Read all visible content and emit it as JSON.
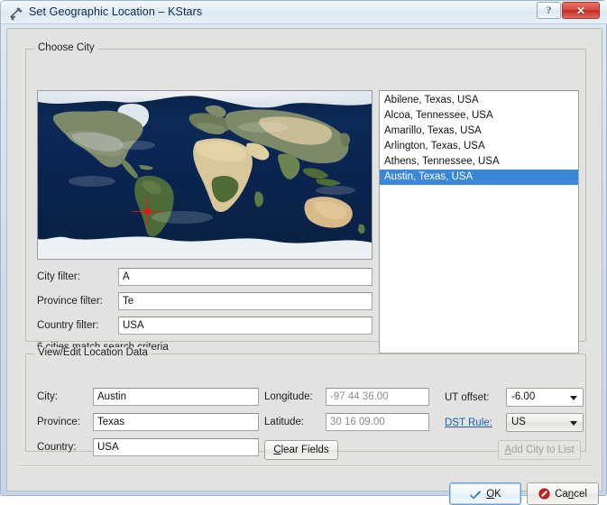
{
  "window": {
    "title": "Set Geographic Location – KStars",
    "icon": "telescope-icon",
    "help_label": "?",
    "close_label": "✕"
  },
  "choose_city": {
    "group_label": "Choose City",
    "map": {
      "name": "world-map",
      "marker_label": "selected-location-marker"
    },
    "filters": [
      {
        "label": "City filter:",
        "value": "A",
        "name": "city-filter-input"
      },
      {
        "label": "Province filter:",
        "value": "Te",
        "name": "province-filter-input"
      },
      {
        "label": "Country filter:",
        "value": "USA",
        "name": "country-filter-input"
      }
    ],
    "match_count_text": "6 cities match search criteria",
    "city_list": [
      {
        "label": "Abilene, Texas, USA",
        "selected": false
      },
      {
        "label": "Alcoa, Tennessee, USA",
        "selected": false
      },
      {
        "label": "Amarillo, Texas, USA",
        "selected": false
      },
      {
        "label": "Arlington, Texas, USA",
        "selected": false
      },
      {
        "label": "Athens, Tennessee, USA",
        "selected": false
      },
      {
        "label": "Austin, Texas, USA",
        "selected": true
      }
    ]
  },
  "location_data": {
    "group_label": "View/Edit Location Data",
    "city": {
      "label": "City:",
      "value": "Austin"
    },
    "province": {
      "label": "Province:",
      "value": "Texas"
    },
    "country": {
      "label": "Country:",
      "value": "USA"
    },
    "longitude": {
      "label": "Longitude:",
      "value": "-97 44 36.00"
    },
    "latitude": {
      "label": "Latitude:",
      "value": "30 16 09.00"
    },
    "ut_offset": {
      "label": "UT offset:",
      "value": "-6.00"
    },
    "dst_rule": {
      "label": "DST Rule:",
      "value": "US"
    },
    "clear_fields_button": {
      "accel": "C",
      "rest": "lear Fields"
    },
    "add_city_button": {
      "accel": "A",
      "rest": "dd City to List"
    }
  },
  "footer": {
    "ok_button": {
      "accel": "O",
      "rest": "K"
    },
    "cancel_button": {
      "pre": "Ca",
      "accel": "n",
      "rest": "cel"
    }
  },
  "colors": {
    "selection_blue": "#3a87d8",
    "link_blue": "#1a5fb4",
    "marker_red": "#ee1111",
    "close_red": "#d8453c",
    "dialog_bg": "#e2e2e0"
  }
}
